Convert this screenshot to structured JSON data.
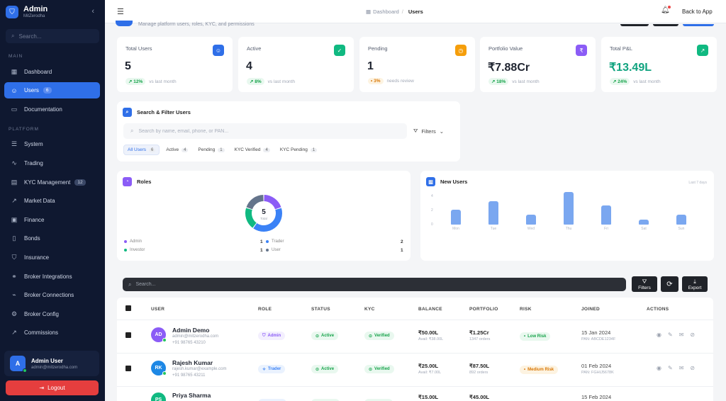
{
  "sidebar": {
    "brand_title": "Admin",
    "brand_sub": "MitZerodha",
    "search_placeholder": "Search...",
    "section_main": "MAIN",
    "section_platform": "PLATFORM",
    "items": [
      {
        "label": "Dashboard",
        "icon": "grid-icon"
      },
      {
        "label": "Users",
        "icon": "users-icon",
        "badge": "6",
        "active": true
      },
      {
        "label": "Documentation",
        "icon": "book-icon"
      },
      {
        "label": "System",
        "icon": "server-icon"
      },
      {
        "label": "Trading",
        "icon": "activity-icon"
      },
      {
        "label": "KYC Management",
        "icon": "id-card-icon",
        "badge": "12"
      },
      {
        "label": "Market Data",
        "icon": "trending-icon"
      },
      {
        "label": "Finance",
        "icon": "wallet-icon"
      },
      {
        "label": "Bonds",
        "icon": "document-icon"
      },
      {
        "label": "Insurance",
        "icon": "shield-icon"
      },
      {
        "label": "Broker Integrations",
        "icon": "link-icon"
      },
      {
        "label": "Broker Connections",
        "icon": "pulse-icon"
      },
      {
        "label": "Broker Config",
        "icon": "gear-icon"
      },
      {
        "label": "Commissions",
        "icon": "chart-up-icon"
      }
    ],
    "user": {
      "initial": "A",
      "name": "Admin User",
      "email": "admin@mitzerodha.com"
    },
    "logout_label": "Logout"
  },
  "topbar": {
    "breadcrumb_root": "Dashboard",
    "breadcrumb_current": "Users",
    "back_label": "Back to App"
  },
  "page": {
    "subtitle": "Manage platform users, roles, KYC, and permissions"
  },
  "stats": [
    {
      "label": "Total Users",
      "value": "5",
      "change": "12%",
      "note": "vs last month",
      "color": "#2f6fe8",
      "icon": "users-icon"
    },
    {
      "label": "Active",
      "value": "4",
      "change": "8%",
      "note": "vs last month",
      "color": "#10b981",
      "icon": "user-check-icon"
    },
    {
      "label": "Pending",
      "value": "1",
      "change": "3%",
      "note": "needs review",
      "color": "#f59e0b",
      "icon": "clock-icon"
    },
    {
      "label": "Portfolio Value",
      "value": "₹7.88Cr",
      "change": "18%",
      "note": "vs last month",
      "color": "#8b5cf6",
      "icon": "rupee-icon"
    },
    {
      "label": "Total P&L",
      "value": "₹13.49L",
      "change": "24%",
      "note": "vs last month",
      "color": "#10b981",
      "icon": "trend-up-icon"
    }
  ],
  "filter_panel": {
    "title": "Search & Filter Users",
    "search_placeholder": "Search by name, email, phone, or PAN...",
    "filters_label": "Filters",
    "chips": [
      {
        "label": "All Users",
        "count": "6",
        "active": true
      },
      {
        "label": "Active",
        "count": "4"
      },
      {
        "label": "Pending",
        "count": "1"
      },
      {
        "label": "KYC Verified",
        "count": "4"
      },
      {
        "label": "KYC Pending",
        "count": "1"
      }
    ]
  },
  "roles_panel": {
    "title": "Roles",
    "total": "5",
    "total_sub": "Total",
    "legend": [
      {
        "name": "Admin",
        "count": "1",
        "color": "#8b5cf6"
      },
      {
        "name": "Trader",
        "count": "2",
        "color": "#3b82f6"
      },
      {
        "name": "Investor",
        "count": "1",
        "color": "#10b981"
      },
      {
        "name": "User",
        "count": "1",
        "color": "#64748b"
      }
    ]
  },
  "new_users_panel": {
    "title": "New Users",
    "range": "Last 7 days"
  },
  "chart_data": [
    {
      "type": "pie",
      "title": "Roles",
      "categories": [
        "Admin",
        "Trader",
        "Investor",
        "User"
      ],
      "values": [
        1,
        2,
        1,
        1
      ],
      "colors": [
        "#8b5cf6",
        "#3b82f6",
        "#10b981",
        "#64748b"
      ]
    },
    {
      "type": "bar",
      "title": "New Users",
      "categories": [
        "Mon",
        "Tue",
        "Wed",
        "Thu",
        "Fri",
        "Sat",
        "Sun"
      ],
      "values": [
        2.1,
        3.3,
        1.4,
        4.6,
        2.7,
        0.7,
        1.4
      ],
      "ylim": [
        0,
        6
      ],
      "yticks": [
        "6",
        "4",
        "2",
        "0"
      ]
    }
  ],
  "table": {
    "search_placeholder": "Search...",
    "filters_btn": "Filters",
    "export_btn": "Export",
    "headers": {
      "user": "USER",
      "role": "ROLE",
      "status": "STATUS",
      "kyc": "KYC",
      "balance": "BALANCE",
      "portfolio": "PORTFOLIO",
      "risk": "RISK",
      "joined": "JOINED",
      "actions": "ACTIONS"
    },
    "rows": [
      {
        "initials": "AD",
        "avatar_color": "#8b5cf6",
        "name": "Admin Demo",
        "email": "admin@mitzerodha.com",
        "phone": "+91 98765 43210",
        "role": "Admin",
        "role_color": "#8b5cf6",
        "role_bg": "#f3effe",
        "status": "Active",
        "kyc": "Verified",
        "balance": "₹50.00L",
        "avail": "Avail: ₹38.00L",
        "portfolio": "₹1.25Cr",
        "orders": "1347 orders",
        "risk": "Low Risk",
        "risk_color": "#16a34a",
        "risk_bg": "#e9f8ef",
        "joined": "15 Jan 2024",
        "pan": "PAN: ABCDE1234F"
      },
      {
        "initials": "RK",
        "avatar_color": "#1e88e5",
        "name": "Rajesh Kumar",
        "email": "rajesh.kumar@example.com",
        "phone": "+91 98765 43211",
        "role": "Trader",
        "role_color": "#3b82f6",
        "role_bg": "#eaf2fe",
        "status": "Active",
        "kyc": "Verified",
        "balance": "₹25.00L",
        "avail": "Avail: ₹7.00L",
        "portfolio": "₹87.50L",
        "orders": "892 orders",
        "risk": "Medium Risk",
        "risk_color": "#d97706",
        "risk_bg": "#fdf3e1",
        "joined": "01 Feb 2024",
        "pan": "PAN: FGHIJ5678K"
      },
      {
        "initials": "PS",
        "avatar_color": "#10b981",
        "name": "Priya Sharma",
        "email": "",
        "phone": "",
        "role": "",
        "role_color": "#10b981",
        "role_bg": "#e9f8ef",
        "status": "",
        "kyc": "",
        "balance": "₹15.00L",
        "avail": "",
        "portfolio": "₹45.00L",
        "orders": "",
        "risk": "",
        "risk_color": "#16a34a",
        "risk_bg": "#e9f8ef",
        "joined": "15 Feb 2024",
        "pan": ""
      }
    ]
  }
}
